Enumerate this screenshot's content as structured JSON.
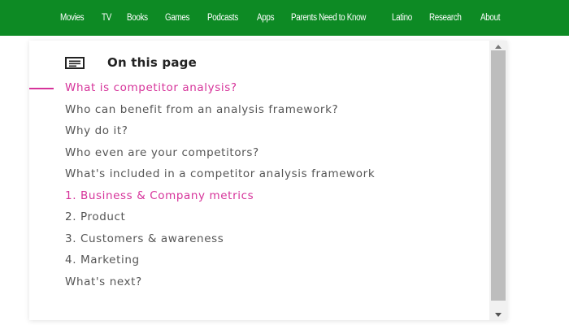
{
  "nav": {
    "items": [
      "Movies",
      "TV",
      "Books",
      "Games",
      "Podcasts",
      "Apps",
      "Parents Need to Know",
      "Latino",
      "Research",
      "About"
    ]
  },
  "toc": {
    "title": "On this page",
    "icon": "list-icon",
    "active_index": 0,
    "accent_color": "#d6339a",
    "items": [
      {
        "label": "What is competitor analysis?",
        "highlight": true
      },
      {
        "label": "Who can benefit from an analysis framework?",
        "highlight": false
      },
      {
        "label": "Why do it?",
        "highlight": false
      },
      {
        "label": "Who even are your competitors?",
        "highlight": false
      },
      {
        "label": "What's included in a competitor analysis framework",
        "highlight": false
      },
      {
        "label": "1. Business & Company metrics",
        "highlight": true
      },
      {
        "label": "2. Product",
        "highlight": false
      },
      {
        "label": "3. Customers & awareness",
        "highlight": false
      },
      {
        "label": "4. Marketing",
        "highlight": false
      },
      {
        "label": "What's next?",
        "highlight": false
      }
    ]
  },
  "colors": {
    "nav_bg": "#0d8a24",
    "accent": "#d6339a"
  }
}
